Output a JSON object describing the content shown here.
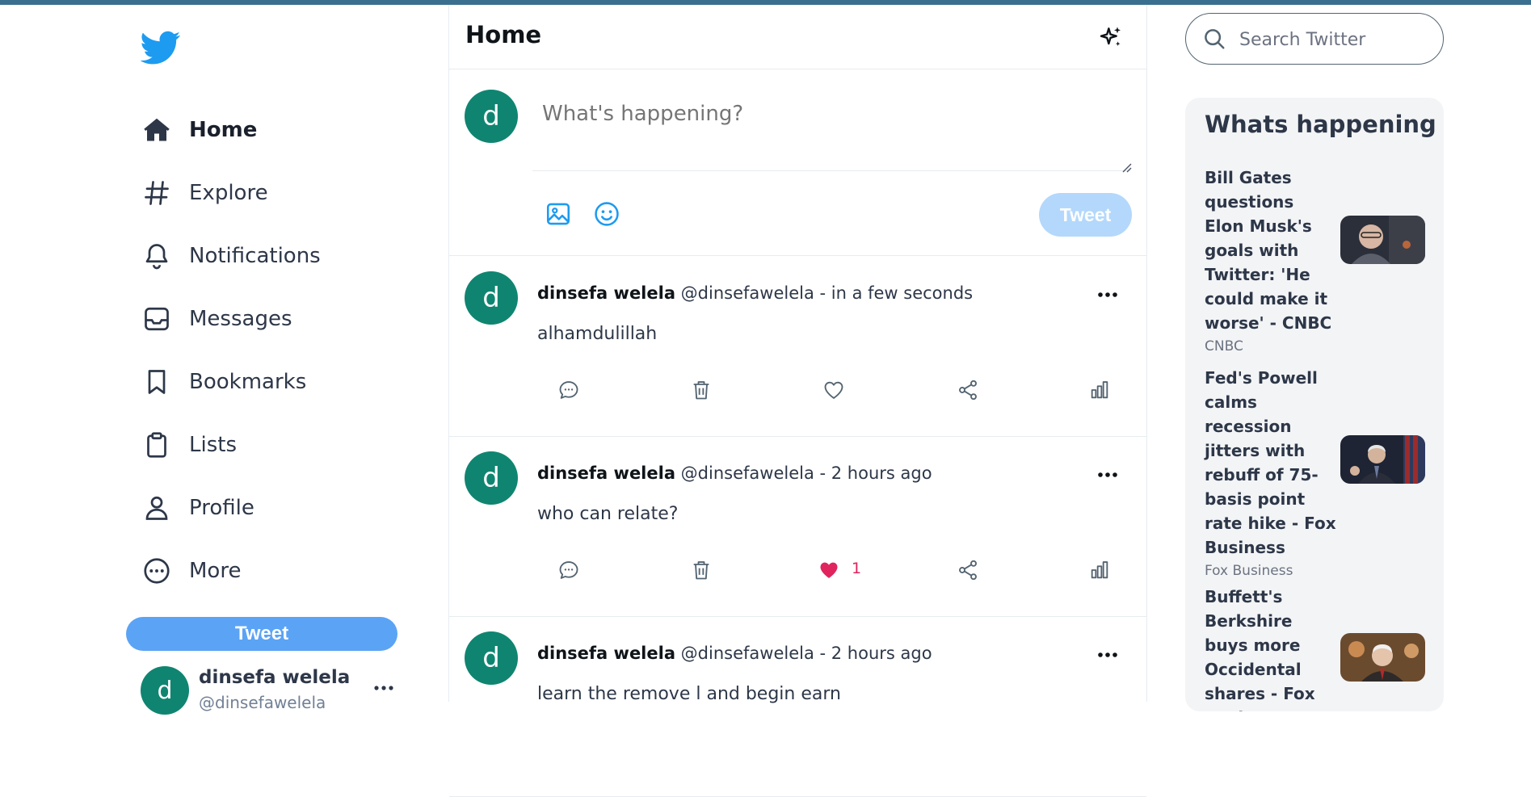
{
  "sidebar": {
    "logo": "twitter-bird-icon",
    "items": [
      {
        "label": "Home",
        "icon": "home-icon",
        "active": true
      },
      {
        "label": "Explore",
        "icon": "hashtag-icon"
      },
      {
        "label": "Notifications",
        "icon": "bell-icon"
      },
      {
        "label": "Messages",
        "icon": "inbox-icon"
      },
      {
        "label": "Bookmarks",
        "icon": "bookmark-icon"
      },
      {
        "label": "Lists",
        "icon": "clipboard-icon"
      },
      {
        "label": "Profile",
        "icon": "user-icon"
      },
      {
        "label": "More",
        "icon": "more-circle-icon"
      }
    ],
    "tweet_button": "Tweet",
    "account": {
      "avatar_letter": "d",
      "name": "dinsefa welela",
      "handle": "@dinsefawelela"
    }
  },
  "header": {
    "title": "Home"
  },
  "compose": {
    "avatar_letter": "d",
    "placeholder": "What's happening?",
    "tweet_button": "Tweet"
  },
  "posts": [
    {
      "avatar_letter": "d",
      "name": "dinsefa welela",
      "meta": " @dinsefawelela - in a few seconds",
      "text": "alhamdulillah",
      "liked": false,
      "likes": ""
    },
    {
      "avatar_letter": "d",
      "name": "dinsefa welela",
      "meta": " @dinsefawelela - 2 hours ago",
      "text": "who can relate?",
      "liked": true,
      "likes": "1"
    },
    {
      "avatar_letter": "d",
      "name": "dinsefa welela",
      "meta": " @dinsefawelela - 2 hours ago",
      "text": "learn the remove l and begin earn",
      "liked": false,
      "likes": ""
    }
  ],
  "search": {
    "placeholder": "Search Twitter"
  },
  "trends": {
    "title": "Whats happening",
    "items": [
      {
        "title": "Bill Gates questions Elon Musk's goals with Twitter: 'He could make it worse' - CNBC",
        "source": "CNBC"
      },
      {
        "title": "Fed's Powell calms recession jitters with rebuff of 75-basis point rate hike - Fox Business",
        "source": "Fox Business"
      },
      {
        "title": "Buffett's Berkshire buys more Occidental shares - Fox Business",
        "source": ""
      }
    ]
  },
  "colors": {
    "brand": "#1d9bf0",
    "avatar": "#0f8571",
    "tweet_button": "#5ba3f5",
    "tweet_button_disabled": "#b3d8fb",
    "like": "#e0245e"
  }
}
